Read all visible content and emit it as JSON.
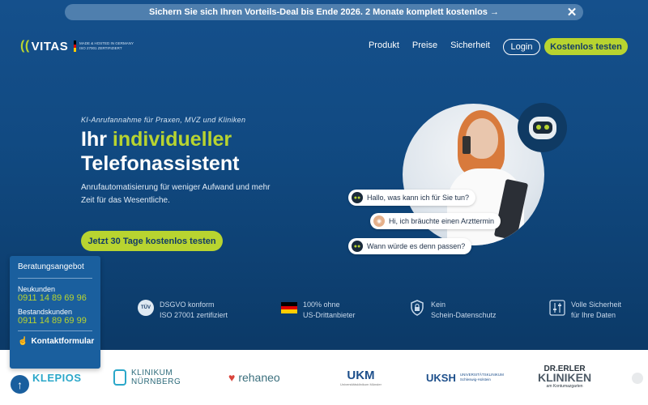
{
  "promo": {
    "text": "Sichern Sie sich Ihren Vorteils-Deal bis Ende 2026. 2 Monate komplett kostenlos →",
    "close": "✕"
  },
  "header": {
    "logo": "VITAS",
    "badge_line1": "MADE & HOSTED IN GERMANY",
    "badge_line2": "ISO 27001 ZERTIFIZIERT",
    "nav": [
      "Produkt",
      "Preise",
      "Sicherheit"
    ],
    "login": "Login",
    "cta": "Kostenlos testen"
  },
  "hero": {
    "kicker": "KI-Anrufannahme für Praxen, MVZ und Kliniken",
    "title_pre": "Ihr ",
    "title_accent": "individueller",
    "title_line2": "Telefonassistent",
    "sub": "Anrufautomatisierung für weniger Aufwand und mehr Zeit für das Wesentliche.",
    "cta": "Jetzt 30 Tage kostenlos testen"
  },
  "chat": {
    "b1": "Hallo, was kann ich für Sie tun?",
    "b2": "Hi, ich bräuchte einen Arzttermin",
    "b3": "Wann würde es denn passen?"
  },
  "trust": [
    {
      "l1": "DSGVO konform",
      "l2": "ISO 27001 zertifiziert",
      "icon": "tuv-seal-icon"
    },
    {
      "l1": "100% ohne",
      "l2": "US-Drittanbieter",
      "icon": "german-flag-icon"
    },
    {
      "l1": "Kein",
      "l2": "Schein-Datenschutz",
      "icon": "shield-lock-icon"
    },
    {
      "l1": "Volle Sicherheit",
      "l2": "für Ihre Daten",
      "icon": "sliders-icon"
    }
  ],
  "logos": {
    "asklepios": "KLEPIOS",
    "klinikum_l1": "KLINIKUM",
    "klinikum_l2": "NÜRNBERG",
    "rehaneo": "rehaneo",
    "ukm": "UKM",
    "ukm_sub": "Universitätsklinikum Münster",
    "uksh": "UKSH",
    "uksh_sub1": "UNIVERSITÄTSKLINIKUM",
    "uksh_sub2": "Schleswig-Holstein",
    "erler_l1": "DR.ERLER",
    "erler_l2": "KLINIKEN",
    "erler_l3": "am Kontumazgarten"
  },
  "contact": {
    "title": "Beratungsangebot",
    "new_label": "Neukunden",
    "new_num": "0911 14 89 69 96",
    "existing_label": "Bestandskunden",
    "existing_num": "0911 14 89 69 99",
    "form": "Kontaktformular"
  },
  "colors": {
    "accent": "#b8d430",
    "navy": "#123c66",
    "blue": "#1a5f9e"
  }
}
